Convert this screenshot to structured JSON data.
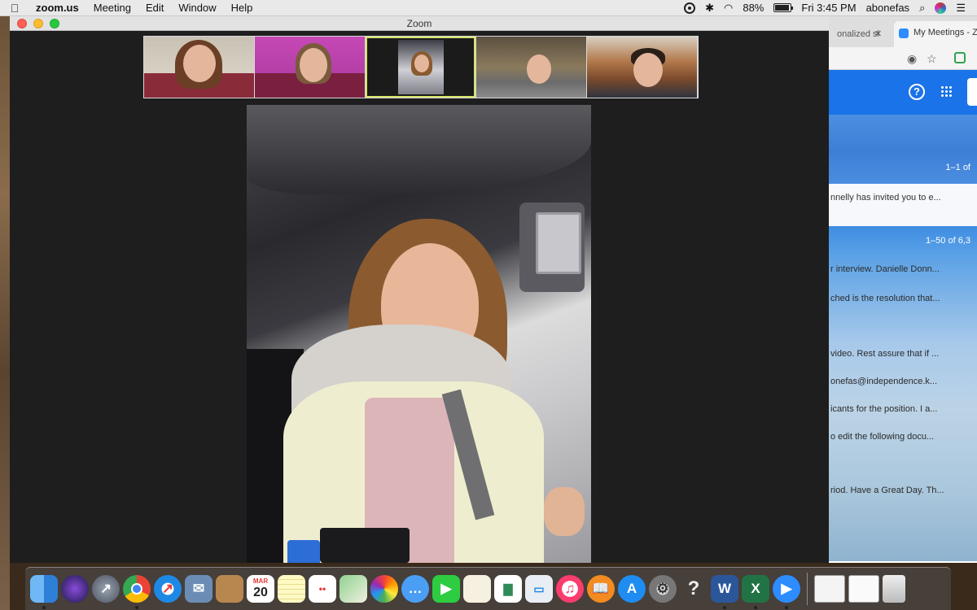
{
  "menubar": {
    "app_name": "zoom.us",
    "items": [
      "Meeting",
      "Edit",
      "Window",
      "Help"
    ],
    "battery": "88%",
    "clock": "Fri 3:45 PM",
    "user": "abonefas"
  },
  "zoom_window": {
    "title": "Zoom",
    "participants": [
      {
        "label": "participant-1"
      },
      {
        "label": "participant-2"
      },
      {
        "label": "participant-3-active"
      },
      {
        "label": "participant-4"
      },
      {
        "label": "participant-5"
      }
    ]
  },
  "chrome": {
    "tab1_title": "onalized sl",
    "tab2_title": "My Meetings - Zo",
    "gmail": {
      "count_1": "1–1 of",
      "row_1": "nnelly has invited you to e...",
      "count_2": "1–50 of 6,3",
      "rows": [
        "r interview. Danielle Donn...",
        "ched is the resolution that...",
        "video. Rest assure that if ...",
        "onefas@independence.k...",
        "icants for the position. I a...",
        "o edit the following docu...",
        "riod. Have a Great Day. Th..."
      ]
    }
  },
  "dock": {
    "calendar_month": "MAR",
    "calendar_day": "20",
    "help_glyph": "?",
    "word_glyph": "W",
    "excel_glyph": "X"
  },
  "colors": {
    "zoom_blue": "#2d8cff",
    "gmail_header": "#1a73e8",
    "active_speaker_border": "#d6e46a"
  }
}
